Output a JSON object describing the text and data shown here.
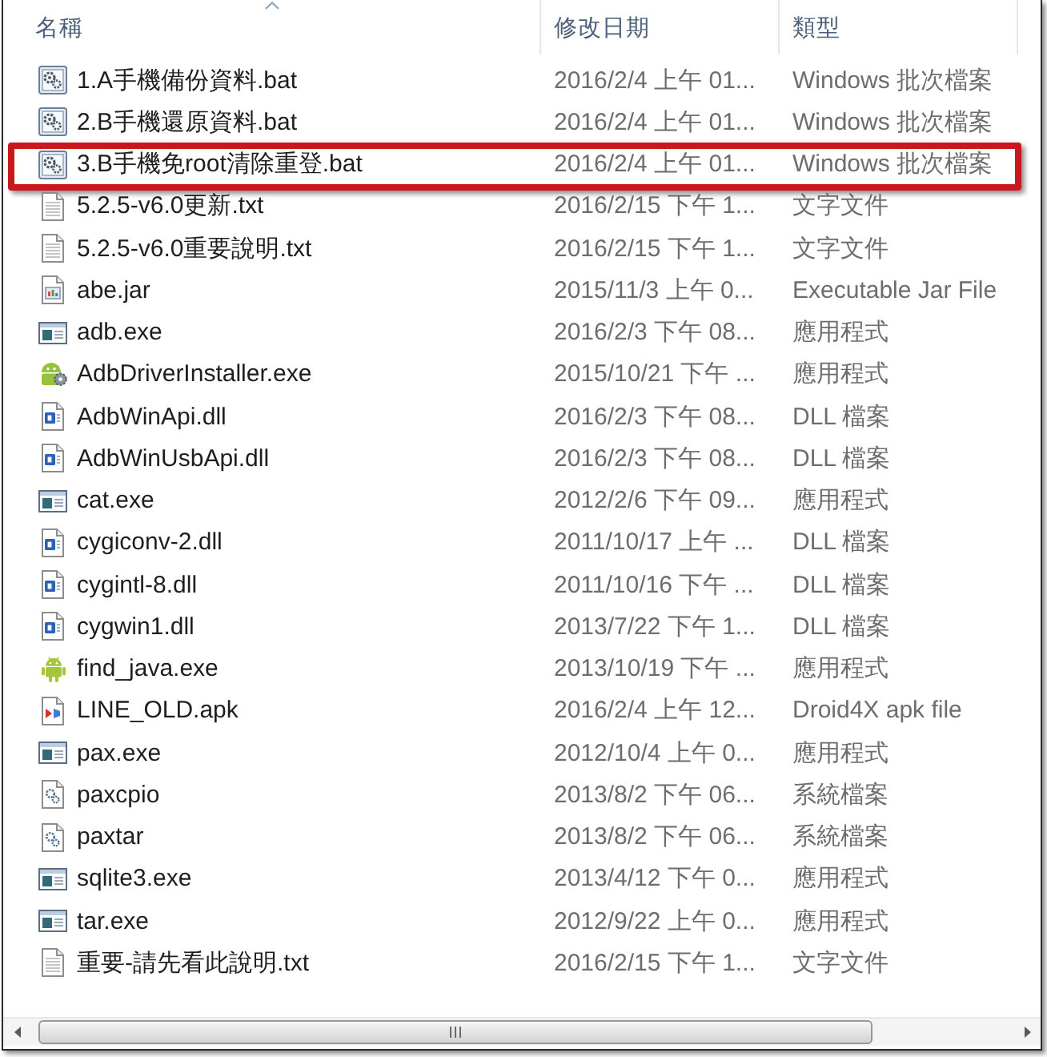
{
  "columns": [
    {
      "label": "名稱",
      "sorted": true
    },
    {
      "label": "修改日期",
      "sorted": false
    },
    {
      "label": "類型",
      "sorted": false
    }
  ],
  "files": [
    {
      "name": "1.A手機備份資料.bat",
      "modified": "2016/2/4 上午 01...",
      "type": "Windows 批次檔案",
      "kind": "batch",
      "highlighted": false
    },
    {
      "name": "2.B手機還原資料.bat",
      "modified": "2016/2/4 上午 01...",
      "type": "Windows 批次檔案",
      "kind": "batch",
      "highlighted": false
    },
    {
      "name": "3.B手機免root清除重登.bat",
      "modified": "2016/2/4 上午 01...",
      "type": "Windows 批次檔案",
      "kind": "batch",
      "highlighted": true
    },
    {
      "name": "5.2.5-v6.0更新.txt",
      "modified": "2016/2/15 下午 1...",
      "type": "文字文件",
      "kind": "text",
      "highlighted": false
    },
    {
      "name": "5.2.5-v6.0重要說明.txt",
      "modified": "2016/2/15 下午 1...",
      "type": "文字文件",
      "kind": "text",
      "highlighted": false
    },
    {
      "name": "abe.jar",
      "modified": "2015/11/3 上午 0...",
      "type": "Executable Jar File",
      "kind": "jar",
      "highlighted": false
    },
    {
      "name": "adb.exe",
      "modified": "2016/2/3 下午 08...",
      "type": "應用程式",
      "kind": "app",
      "highlighted": false
    },
    {
      "name": "AdbDriverInstaller.exe",
      "modified": "2015/10/21 下午 ...",
      "type": "應用程式",
      "kind": "installer",
      "highlighted": false
    },
    {
      "name": "AdbWinApi.dll",
      "modified": "2016/2/3 下午 08...",
      "type": "DLL 檔案",
      "kind": "dll",
      "highlighted": false
    },
    {
      "name": "AdbWinUsbApi.dll",
      "modified": "2016/2/3 下午 08...",
      "type": "DLL 檔案",
      "kind": "dll",
      "highlighted": false
    },
    {
      "name": "cat.exe",
      "modified": "2012/2/6 下午 09...",
      "type": "應用程式",
      "kind": "app",
      "highlighted": false
    },
    {
      "name": "cygiconv-2.dll",
      "modified": "2011/10/17 上午 ...",
      "type": "DLL 檔案",
      "kind": "dll",
      "highlighted": false
    },
    {
      "name": "cygintl-8.dll",
      "modified": "2011/10/16 下午 ...",
      "type": "DLL 檔案",
      "kind": "dll",
      "highlighted": false
    },
    {
      "name": "cygwin1.dll",
      "modified": "2013/7/22 下午 1...",
      "type": "DLL 檔案",
      "kind": "dll",
      "highlighted": false
    },
    {
      "name": "find_java.exe",
      "modified": "2013/10/19 下午 ...",
      "type": "應用程式",
      "kind": "android",
      "highlighted": false
    },
    {
      "name": "LINE_OLD.apk",
      "modified": "2016/2/4 上午 12...",
      "type": "Droid4X apk file",
      "kind": "apk",
      "highlighted": false
    },
    {
      "name": "pax.exe",
      "modified": "2012/10/4 上午 0...",
      "type": "應用程式",
      "kind": "app",
      "highlighted": false
    },
    {
      "name": "paxcpio",
      "modified": "2013/8/2 下午 06...",
      "type": "系統檔案",
      "kind": "system",
      "highlighted": false
    },
    {
      "name": "paxtar",
      "modified": "2013/8/2 下午 06...",
      "type": "系統檔案",
      "kind": "system",
      "highlighted": false
    },
    {
      "name": "sqlite3.exe",
      "modified": "2013/4/12 下午 0...",
      "type": "應用程式",
      "kind": "app",
      "highlighted": false
    },
    {
      "name": "tar.exe",
      "modified": "2012/9/22 上午 0...",
      "type": "應用程式",
      "kind": "app",
      "highlighted": false
    },
    {
      "name": "重要-請先看此說明.txt",
      "modified": "2016/2/15 下午 1...",
      "type": "文字文件",
      "kind": "text",
      "highlighted": false
    }
  ]
}
